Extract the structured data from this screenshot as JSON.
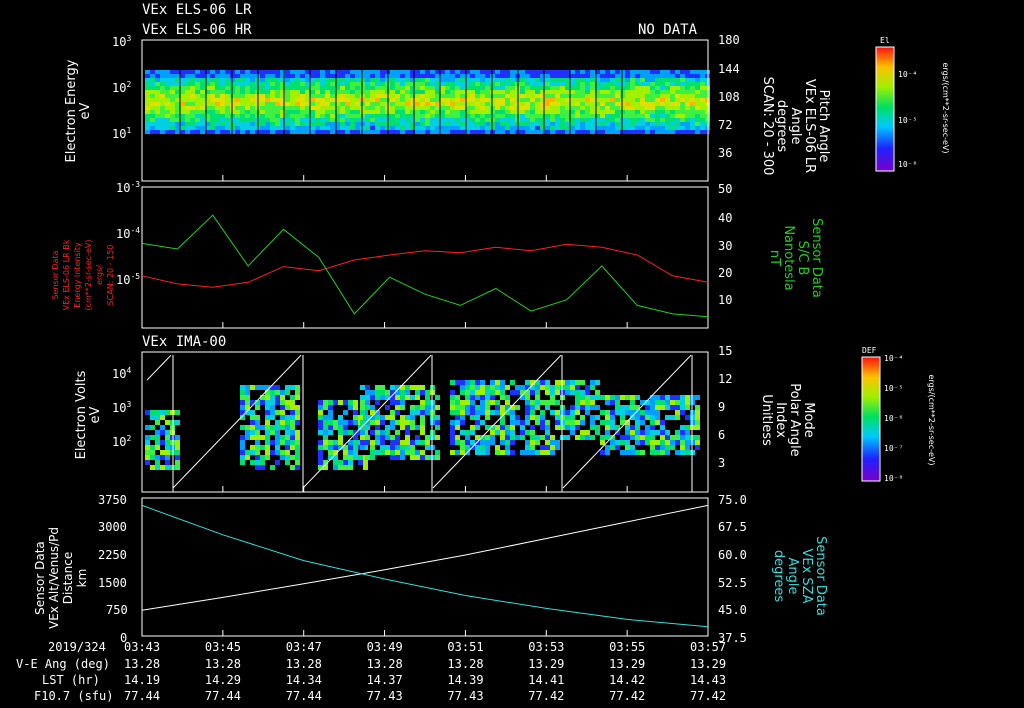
{
  "titles": {
    "line1": "VEx ELS-06 LR",
    "line2": "VEx ELS-06 HR",
    "no_data": "NO DATA",
    "ima": "VEx IMA-00"
  },
  "panel1": {
    "ylabel": [
      "Electron Energy",
      "eV"
    ],
    "y_ticks": [
      "10",
      "10",
      "10"
    ],
    "y_exps": [
      "3",
      "2",
      "1"
    ],
    "right_ticks": [
      "180",
      "144",
      "108",
      "72",
      "36"
    ],
    "right_label": [
      "Pitch Angle",
      "VEx ELS-06 LR",
      "Angle",
      "degrees",
      "SCAN: 20 - 300"
    ],
    "colorbar_title": "El",
    "colorbar_ticks": [
      "10⁻⁴",
      "10⁻⁵",
      "10⁻⁶"
    ],
    "colorbar_unit": "ergs/(cm**2-sr-sec-eV)"
  },
  "panel2": {
    "left_label": [
      "Sensor Data",
      "VEx ELS-06 LR Bk",
      "Energy Intensity",
      "(cm**2-sr-sec-eV)",
      "ergs/",
      "SCAN: 20 - 150"
    ],
    "y_ticks": [
      "10",
      "10",
      "10"
    ],
    "y_exps": [
      "-3",
      "-4",
      "-5"
    ],
    "right_ticks": [
      "50",
      "40",
      "30",
      "20",
      "10"
    ],
    "right_label": [
      "Sensor Data",
      "S/C B",
      "Nanotesla",
      "nT"
    ]
  },
  "panel3": {
    "ylabel": [
      "Electron Volts",
      "eV"
    ],
    "y_ticks": [
      "10",
      "10",
      "10"
    ],
    "y_exps": [
      "4",
      "3",
      "2"
    ],
    "right_ticks": [
      "15",
      "12",
      "9",
      "6",
      "3"
    ],
    "right_label": [
      "Mode",
      "Polar Angle",
      "Index",
      "Unitless"
    ],
    "colorbar_title": "DEF",
    "colorbar_ticks": [
      "10⁻⁴",
      "10⁻⁵",
      "10⁻⁶",
      "10⁻⁷",
      "10⁻⁸"
    ],
    "colorbar_unit": "ergs/(cm**2-sr-sec-eV)"
  },
  "panel4": {
    "left_label": [
      "Sensor Data",
      "VEx Alt/Venus/Pd",
      "Distance",
      "km"
    ],
    "y_ticks": [
      "3750",
      "3000",
      "2250",
      "1500",
      "750",
      "0"
    ],
    "right_ticks": [
      "75.0",
      "67.5",
      "60.0",
      "52.5",
      "45.0",
      "37.5"
    ],
    "right_label": [
      "Sensor Data",
      "VEx SZA",
      "Angle",
      "degrees"
    ]
  },
  "footer": {
    "row_labels": [
      "2019/324",
      "V-E Ang (deg)",
      "LST (hr)",
      "F10.7 (sfu)"
    ],
    "times": [
      "03:43",
      "03:45",
      "03:47",
      "03:49",
      "03:51",
      "03:53",
      "03:55",
      "03:57"
    ],
    "ve_ang": [
      "13.28",
      "13.28",
      "13.28",
      "13.28",
      "13.28",
      "13.29",
      "13.29",
      "13.29"
    ],
    "lst": [
      "14.19",
      "14.29",
      "14.34",
      "14.37",
      "14.39",
      "14.41",
      "14.42",
      "14.43"
    ],
    "f107": [
      "77.44",
      "77.44",
      "77.44",
      "77.43",
      "77.43",
      "77.42",
      "77.42",
      "77.42"
    ]
  },
  "chart_data": {
    "type": "line",
    "x_range": [
      "03:43",
      "03:57"
    ],
    "series": [
      {
        "name": "VEx ELS-06 LR Bk",
        "color": "#ff2020",
        "values_approx": [
          2e-05,
          1.4e-05,
          1.2e-05,
          1.5e-05,
          3e-05,
          2.5e-05,
          4e-05,
          5e-05,
          6e-05,
          5.5e-05,
          7e-05,
          6e-05,
          8e-05,
          7e-05,
          5e-05,
          2e-05,
          1.5e-05
        ]
      },
      {
        "name": "S/C B",
        "color": "#20d020",
        "values_approx": [
          30,
          28,
          40,
          22,
          35,
          25,
          5,
          18,
          12,
          8,
          14,
          6,
          10,
          22,
          8,
          5,
          4
        ]
      },
      {
        "name": "VEx Alt/Venus/Pd",
        "color": "#ffffff",
        "units": "km",
        "values": [
          700,
          1050,
          1420,
          1800,
          2200,
          2650,
          3100,
          3550
        ]
      },
      {
        "name": "VEx SZA",
        "color": "#33dddd",
        "units": "degrees",
        "values": [
          73,
          65,
          58,
          53,
          48.5,
          45,
          42,
          40
        ]
      }
    ]
  }
}
